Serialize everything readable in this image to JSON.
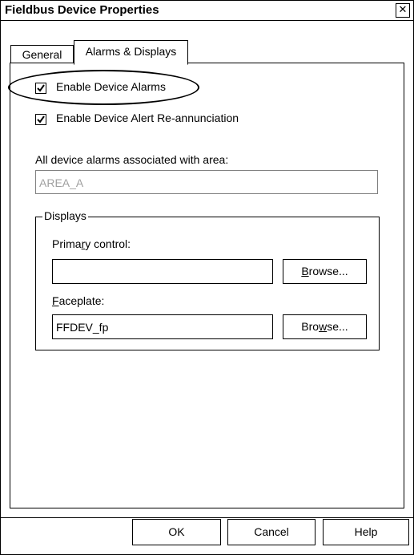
{
  "window": {
    "title": "Fieldbus Device Properties",
    "close_glyph": "✕"
  },
  "tabs": [
    {
      "label": "General",
      "active": false
    },
    {
      "label": "Alarms & Displays",
      "active": true
    }
  ],
  "alarms": {
    "enable_device_alarms": {
      "label": "Enable Device Alarms",
      "checked": true
    },
    "enable_reannunciation": {
      "label": "Enable Device Alert Re-annunciation",
      "checked": true
    },
    "area_label": "All device alarms associated with area:",
    "area_value": "AREA_A"
  },
  "displays": {
    "group_label": "Displays",
    "primary_control": {
      "label_pre": "Prima",
      "label_accel": "r",
      "label_post": "y control:",
      "value": "",
      "browse_pre": "",
      "browse_accel": "B",
      "browse_post": "rowse..."
    },
    "faceplate": {
      "label_pre": "",
      "label_accel": "F",
      "label_post": "aceplate:",
      "value": "FFDEV_fp",
      "browse_pre": "Bro",
      "browse_accel": "w",
      "browse_post": "se..."
    }
  },
  "footer": {
    "ok": "OK",
    "cancel": "Cancel",
    "help": "Help"
  }
}
